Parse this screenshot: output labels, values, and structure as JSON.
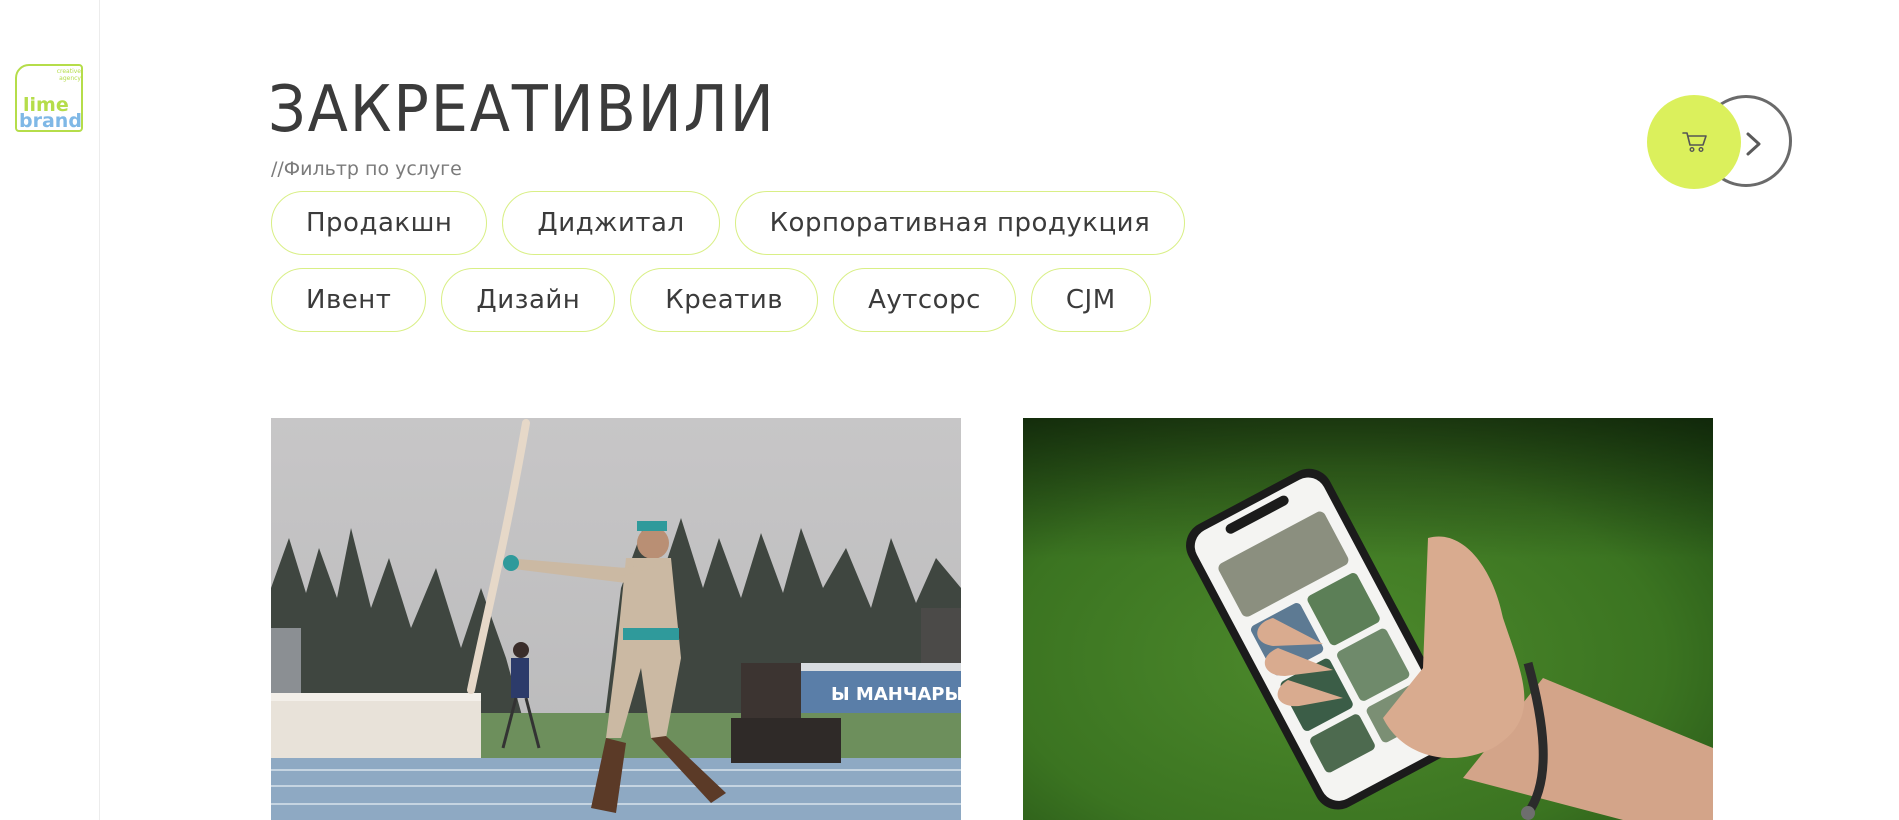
{
  "logo": {
    "small_text": "creative\nagency",
    "word1": "lime",
    "word2": "brand"
  },
  "title": "ЗАКРЕАТИВИЛИ",
  "filter_label": "//Фильтр по услуге",
  "filters": {
    "row1": [
      "Продакшн",
      "Диджитал",
      "Корпоративная продукция"
    ],
    "row2": [
      "Ивент",
      "Дизайн",
      "Креатив",
      "Аутсорс",
      "CJM"
    ]
  },
  "icons": {
    "cart": "cart-icon",
    "next": "chevron-right-icon"
  },
  "colors": {
    "accent": "#dbf05c",
    "chip_border": "#d9ef86",
    "logo_green": "#b5dd4a",
    "logo_blue": "#7fb8e6"
  },
  "cards": [
    {
      "image": "archer-in-costume-on-stadium-photo"
    },
    {
      "image": "hand-holding-smartphone-on-grass-photo"
    }
  ]
}
